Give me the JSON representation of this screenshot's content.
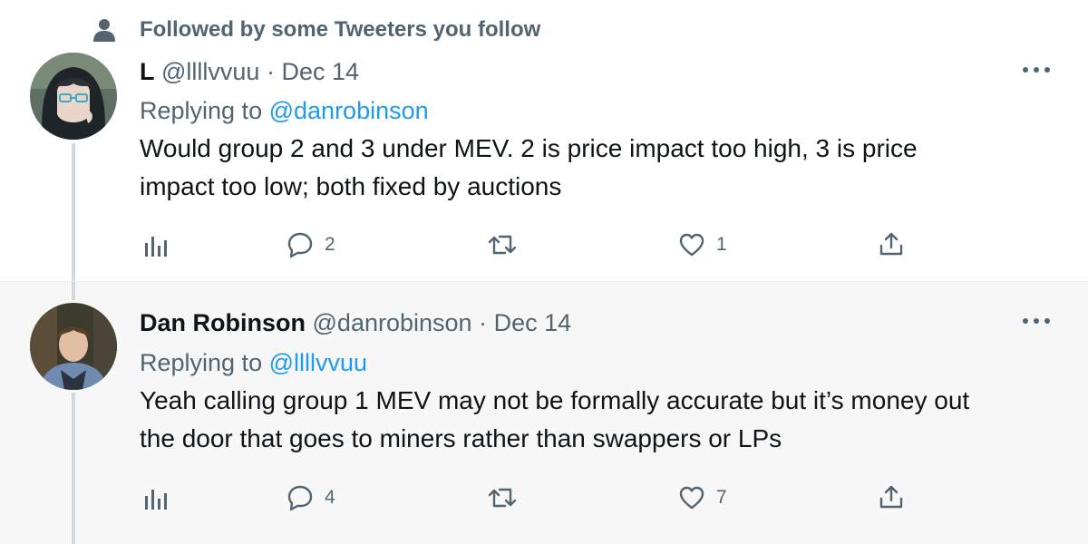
{
  "social_context": {
    "text": "Followed by some Tweeters you follow",
    "icon": "person-icon"
  },
  "colors": {
    "accent": "#1d9bf0",
    "muted": "#536471",
    "text": "#0f1419",
    "thread_line": "#cfd9de",
    "reply_bg": "#f7f7f7"
  },
  "tweets": [
    {
      "display_name": "L",
      "handle": "@llllvvuu",
      "separator": "·",
      "date": "Dec 14",
      "replying_prefix": "Replying to",
      "replying_to": "@danrobinson",
      "text_line1": "Would group 2 and 3 under MEV. 2 is price impact too high, 3 is price",
      "text_line2": "impact too low; both fixed by auctions",
      "replies": "2",
      "likes": "1",
      "more_icon": "more-icon"
    },
    {
      "display_name": "Dan Robinson",
      "handle": "@danrobinson",
      "separator": "·",
      "date": "Dec 14",
      "replying_prefix": "Replying to",
      "replying_to": "@llllvvuu",
      "text_line1": "Yeah calling group 1 MEV may not be formally accurate but it’s money out",
      "text_line2": "the door that goes to miners rather than swappers or LPs",
      "replies": "4",
      "likes": "7",
      "more_icon": "more-icon"
    }
  ]
}
